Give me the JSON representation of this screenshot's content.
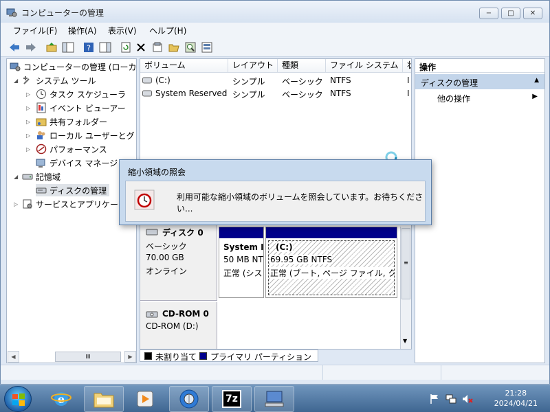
{
  "window": {
    "title": "コンピューターの管理",
    "minimize": "−",
    "maximize": "□",
    "close": "✕"
  },
  "menu": [
    "ファイル(F)",
    "操作(A)",
    "表示(V)",
    "ヘルプ(H)"
  ],
  "tree": {
    "root": "コンピューターの管理 (ローカ",
    "system_tools": "システム ツール",
    "task_scheduler": "タスク スケジューラ",
    "event_viewer": "イベント ビューアー",
    "shared_folders": "共有フォルダー",
    "local_users": "ローカル ユーザーとグ",
    "performance": "パフォーマンス",
    "device_manager": "デバイス マネージ",
    "storage": "記憶域",
    "disk_management": "ディスクの管理",
    "services": "サービスとアプリケー"
  },
  "volume_table": {
    "headers": [
      "ボリューム",
      "レイアウト",
      "種類",
      "ファイル システム",
      "状"
    ],
    "rows": [
      {
        "volume": "(C:)",
        "layout": "シンプル",
        "type": "ベーシック",
        "fs": "NTFS",
        "status": "I"
      },
      {
        "volume": "System Reserved",
        "layout": "シンプル",
        "type": "ベーシック",
        "fs": "NTFS",
        "status": "I"
      }
    ]
  },
  "actions": {
    "header": "操作",
    "selected": "ディスクの管理",
    "other": "他の操作"
  },
  "dialog": {
    "title": "縮小領域の照会",
    "message": "利用可能な縮小領域のボリュームを照会しています。お待ちください..."
  },
  "disks": {
    "disk0": {
      "name": "ディスク 0",
      "type": "ベーシック",
      "size": "70.00 GB",
      "status": "オンライン"
    },
    "part_system": {
      "name": "System I",
      "size": "50 MB NT",
      "status": "正常 (シス"
    },
    "part_c": {
      "name": "(C:)",
      "size": "69.95 GB NTFS",
      "status": "正常 (ブート, ページ ファイル, ク"
    },
    "cdrom": {
      "name": "CD-ROM 0",
      "sub": "CD-ROM (D:)"
    }
  },
  "legend": {
    "unallocated": "未割り当て",
    "primary": "プライマリ パーティション",
    "unallocated_color": "#000000",
    "primary_color": "#00008b"
  },
  "taskbar": {
    "time": "21:28",
    "date": "2024/04/21"
  }
}
